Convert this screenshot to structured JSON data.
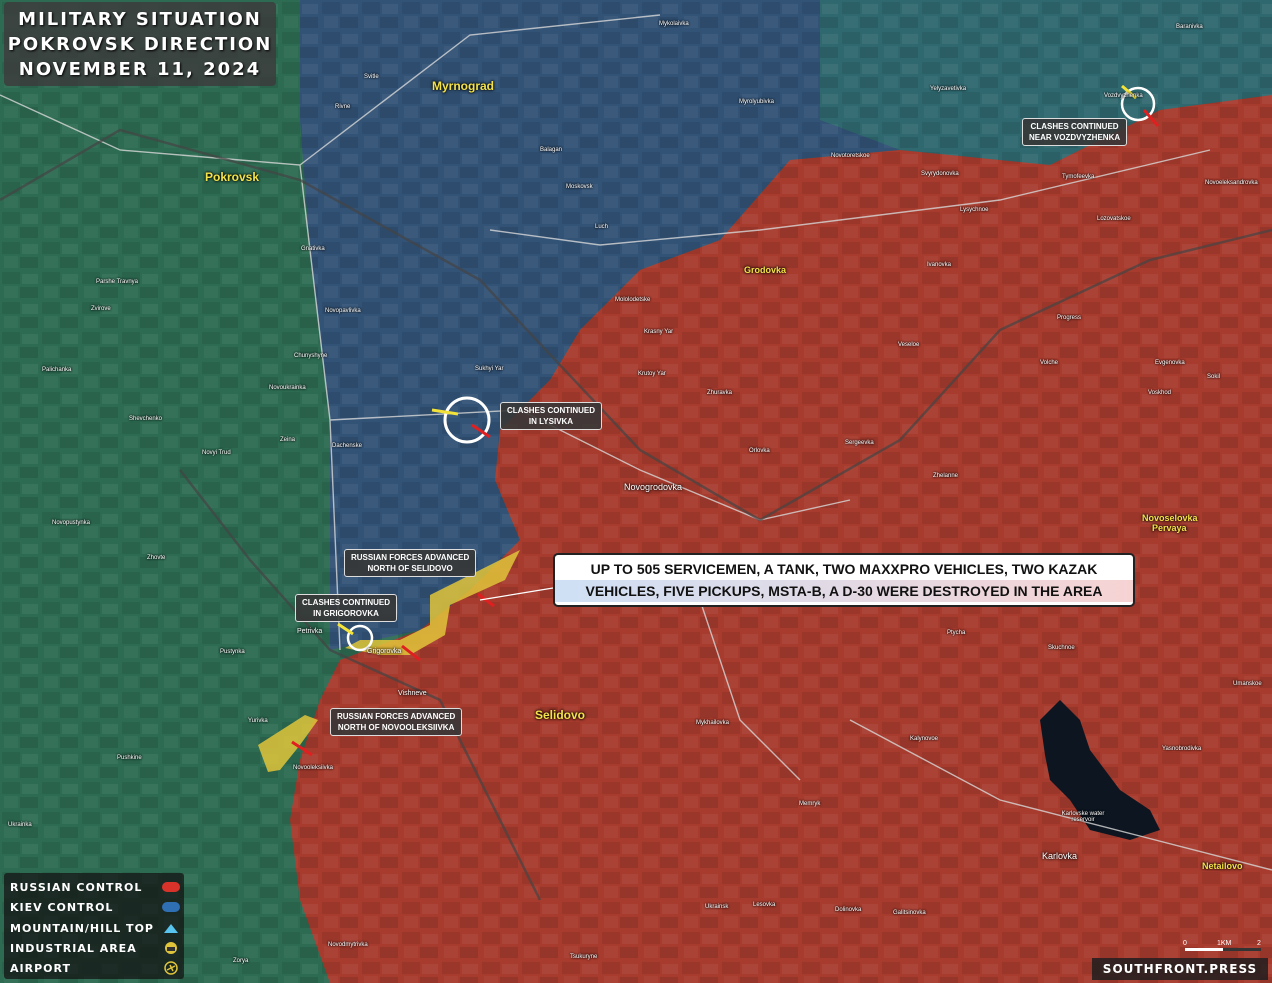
{
  "title": {
    "line1": "MILITARY SITUATION",
    "line2": "POKROVSK DIRECTION",
    "line3": "NOVEMBER 11, 2024"
  },
  "colors": {
    "russian": "#b5362a",
    "kiev": "#2f5f93",
    "advance": "#e0c43a",
    "terrain_green": "#2d6b52",
    "terrain_blue": "#33507a"
  },
  "cities": {
    "pokrovsk": "Pokrovsk",
    "myrnograd": "Myrnograd",
    "selidovo": "Selidovo",
    "grodovka": "Grodovka",
    "novoselovka": "Novoselovka",
    "pervaya": "Pervaya",
    "novogrodovka": "Novogrodovka",
    "netailovo": "Netailovo",
    "karlovka": "Karlovka",
    "vishneve": "Vishneve",
    "petrivka": "Petrivka",
    "grigorovka": "Grigorovka"
  },
  "towns": [
    "Mykolaivka",
    "Baranivka",
    "Svitle",
    "Rivne",
    "Myrolyubivka",
    "Yelyzavetivka",
    "Vozdvyzhenka",
    "Novotoretskoe",
    "Svyrydonovka",
    "Tymofeevka",
    "Novoeleksandrovka",
    "Lysychnoe",
    "Lozovatskoe",
    "Ivanovka",
    "Balagan",
    "Moskovsk",
    "Luch",
    "Gnativka",
    "Parshe Travnya",
    "Zvirove",
    "Novopavlivka",
    "Mololodetske",
    "Krasny Yar",
    "Krutoy Yar",
    "Progress",
    "Veseloe",
    "Volche",
    "Evgenovka",
    "Sokil",
    "Voskhod",
    "Chunyshyne",
    "Palichanka",
    "Novoukrainka",
    "Shevchenko",
    "Sukhyi Yar",
    "Zhuravka",
    "Orlovka",
    "Sergeevka",
    "Zhelanne",
    "Novyi Trud",
    "Zeina",
    "Dachenske",
    "Novopustynka",
    "Zhovte",
    "Pustynka",
    "Yurivka",
    "Pushkine",
    "Novooleksiivka",
    "Ptycha",
    "Skuchnoe",
    "Umanskoe",
    "Mykhailovka",
    "Kalynovoe",
    "Yasnobrodivka",
    "Memryk",
    "Ukrainsk",
    "Lesovka",
    "Dolinovka",
    "Galitsinovka",
    "Tsukuryne",
    "Novodmytrivka",
    "Zorya",
    "Ukrainka",
    "Karlovske water reservoir"
  ],
  "labels": {
    "vozdvyzhenka": [
      "CLASHES CONTINUED",
      "NEAR VOZDVYZHENKA"
    ],
    "lysivka": [
      "CLASHES CONTINUED",
      "IN LYSIVKA"
    ],
    "selidovo_north": [
      "RUSSIAN FORCES ADVANCED",
      "NORTH OF SELIDOVO"
    ],
    "grigorovka": [
      "CLASHES CONTINUED",
      "IN GRIGOROVKA"
    ],
    "novooleksiivka": [
      "RUSSIAN FORCES ADVANCED",
      "NORTH OF NOVOOLEKSIIVKA"
    ]
  },
  "summary": {
    "line1": "UP TO 505 SERVICEMEN, A TANK, TWO MAXXPRO VEHICLES, TWO KAZAK",
    "line2": "VEHICLES, FIVE PICKUPS, MSTA-B, A D-30 WERE DESTROYED IN THE AREA"
  },
  "legend": [
    {
      "label": "RUSSIAN CONTROL",
      "icon": "red-swatch"
    },
    {
      "label": "KIEV CONTROL",
      "icon": "blue-swatch"
    },
    {
      "label": "MOUNTAIN/HILL TOP",
      "icon": "triangle-icon"
    },
    {
      "label": "INDUSTRIAL AREA",
      "icon": "factory-icon"
    },
    {
      "label": "AIRPORT",
      "icon": "airplane-icon"
    }
  ],
  "scale": {
    "zero": "0",
    "unit": "1KM",
    "two": "2"
  },
  "brand": "SOUTHFRONT.PRESS"
}
